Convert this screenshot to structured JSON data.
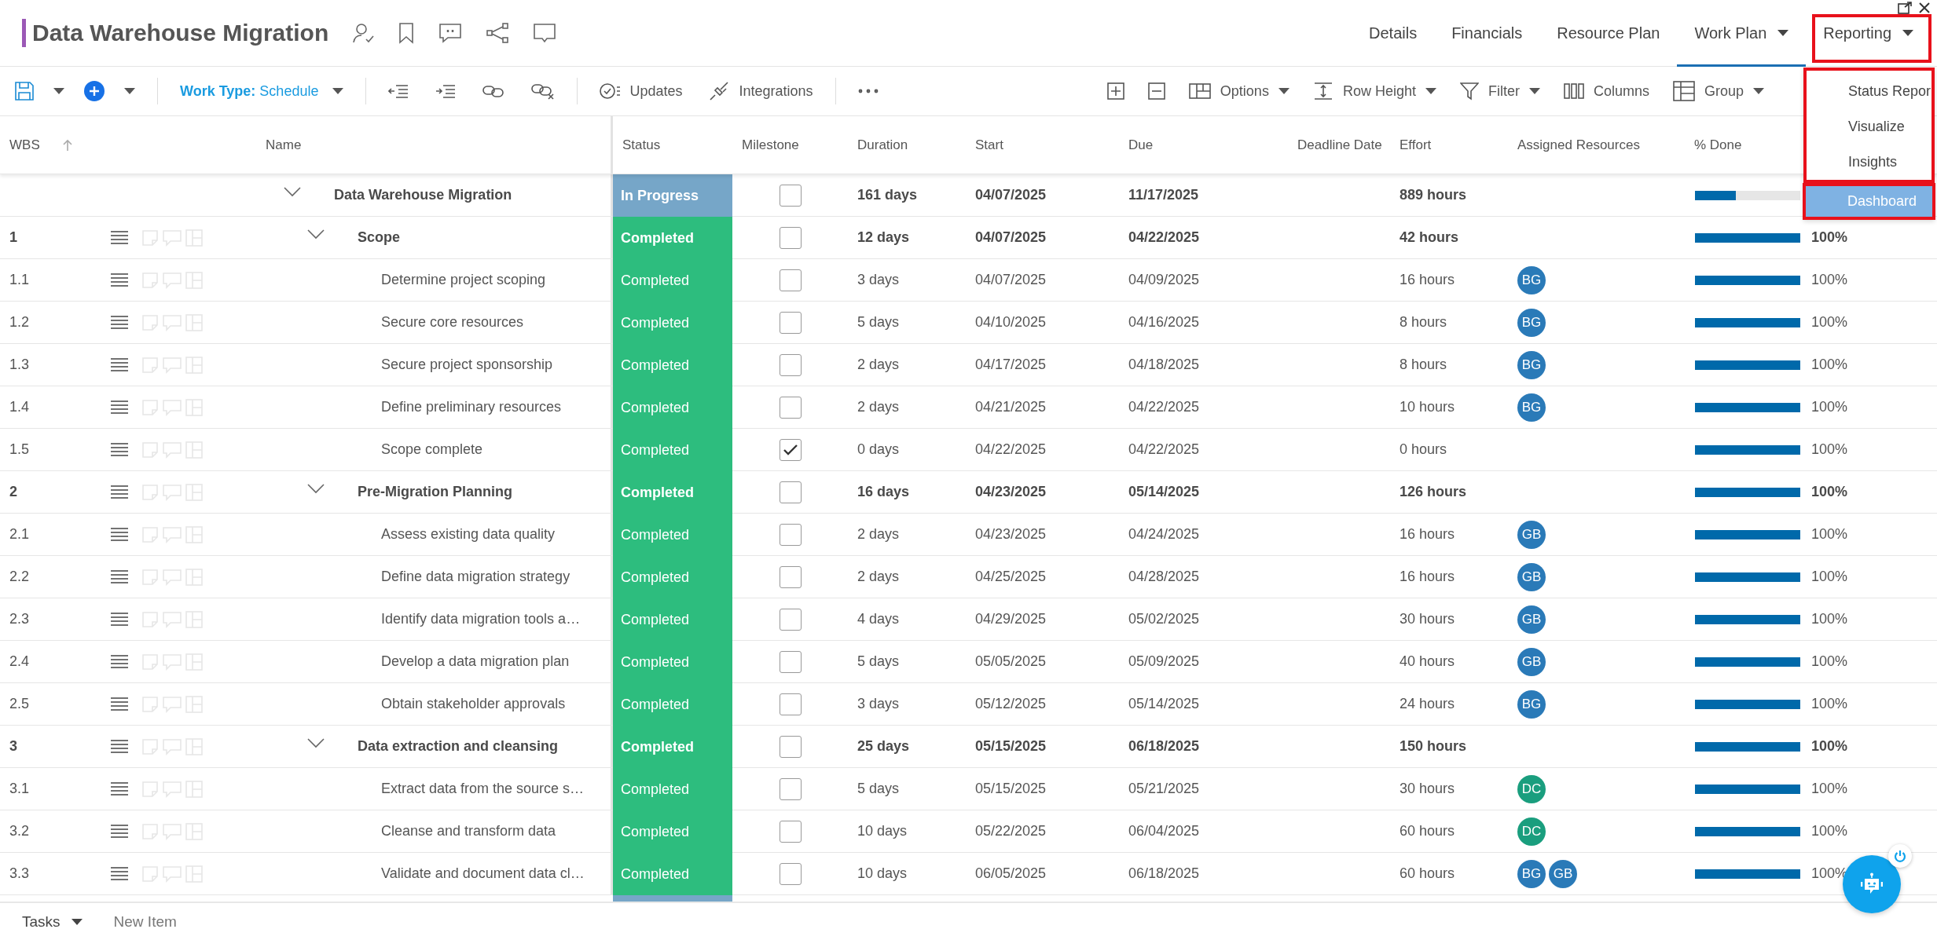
{
  "header": {
    "title": "Data Warehouse Migration",
    "tabs": [
      {
        "label": "Details",
        "selected": false,
        "dropdown": false
      },
      {
        "label": "Financials",
        "selected": false,
        "dropdown": false
      },
      {
        "label": "Resource Plan",
        "selected": false,
        "dropdown": false
      },
      {
        "label": "Work Plan",
        "selected": true,
        "dropdown": true
      },
      {
        "label": "Reporting",
        "selected": false,
        "dropdown": true
      }
    ]
  },
  "toolbar": {
    "work_type": "**Work Type:** Schedule",
    "left_buttons": [
      "Updates",
      "Integrations"
    ],
    "right_buttons": [
      {
        "label": "Options",
        "dropdown": true
      },
      {
        "label": "Row Height",
        "dropdown": true
      },
      {
        "label": "Filter",
        "dropdown": true
      },
      {
        "label": "Columns",
        "dropdown": false
      },
      {
        "label": "Group",
        "dropdown": true
      }
    ]
  },
  "table": {
    "columns": [
      {
        "label": "WBS",
        "sorted": true
      },
      {
        "label": "Name"
      },
      {
        "label": "Status"
      },
      {
        "label": "Milestone"
      },
      {
        "label": "Duration"
      },
      {
        "label": "Start"
      },
      {
        "label": "Due"
      },
      {
        "label": "Deadline Date"
      },
      {
        "label": "Effort"
      },
      {
        "label": "Assigned Resources"
      },
      {
        "label": "% Done"
      }
    ],
    "rows": [
      {
        "name": "Data Warehouse Migration",
        "expanded": true,
        "status": {
          "text": "In Progress",
          "color": "#76a6c8"
        },
        "milestone": false,
        "duration": "161 days",
        "start": "04/07/2025",
        "due": "11/17/2025",
        "effort": "889 hours",
        "level": 0.39,
        "children": [
          {
            "wbs": "1",
            "name": "Scope",
            "expanded": true,
            "status": {
              "text": "Completed",
              "color": "#2dbd7e"
            },
            "milestone": false,
            "duration": "12 days",
            "start": "04/07/2025",
            "due": "04/22/2025",
            "effort": "42 hours",
            "level": 1,
            "percent": "100%",
            "children": [
              {
                "wbs": "1.1",
                "name": "Determine project scoping",
                "status": {
                  "text": "Completed",
                  "color": "#2dbd7e"
                },
                "milestone": false,
                "duration": "3 days",
                "start": "04/07/2025",
                "due": "04/09/2025",
                "effort": "16 hours",
                "resources": [
                  {
                    "initials": "BG",
                    "color": "#2a7ab8"
                  }
                ],
                "level": 1,
                "percent": "100%"
              },
              {
                "wbs": "1.2",
                "name": "Secure core resources",
                "status": {
                  "text": "Completed",
                  "color": "#2dbd7e"
                },
                "milestone": false,
                "duration": "5 days",
                "start": "04/10/2025",
                "due": "04/16/2025",
                "effort": "8 hours",
                "resources": [
                  {
                    "initials": "BG",
                    "color": "#2a7ab8"
                  }
                ],
                "level": 1,
                "percent": "100%"
              },
              {
                "wbs": "1.3",
                "name": "Secure project sponsorship",
                "status": {
                  "text": "Completed",
                  "color": "#2dbd7e"
                },
                "milestone": false,
                "duration": "2 days",
                "start": "04/17/2025",
                "due": "04/18/2025",
                "effort": "8 hours",
                "resources": [
                  {
                    "initials": "BG",
                    "color": "#2a7ab8"
                  }
                ],
                "level": 1,
                "percent": "100%"
              },
              {
                "wbs": "1.4",
                "name": "Define preliminary resources",
                "status": {
                  "text": "Completed",
                  "color": "#2dbd7e"
                },
                "milestone": false,
                "duration": "2 days",
                "start": "04/21/2025",
                "due": "04/22/2025",
                "effort": "10 hours",
                "resources": [
                  {
                    "initials": "BG",
                    "color": "#2a7ab8"
                  }
                ],
                "level": 1,
                "percent": "100%"
              },
              {
                "wbs": "1.5",
                "name": "Scope complete",
                "status": {
                  "text": "Completed",
                  "color": "#2dbd7e"
                },
                "milestone": true,
                "duration": "0 days",
                "start": "04/22/2025",
                "due": "04/22/2025",
                "effort": "0 hours",
                "level": 1,
                "percent": "100%"
              }
            ]
          },
          {
            "wbs": "2",
            "name": "Pre-Migration Planning",
            "expanded": true,
            "status": {
              "text": "Completed",
              "color": "#2dbd7e"
            },
            "milestone": false,
            "duration": "16 days",
            "start": "04/23/2025",
            "due": "05/14/2025",
            "effort": "126 hours",
            "level": 1,
            "percent": "100%",
            "children": [
              {
                "wbs": "2.1",
                "name": "Assess existing data quality",
                "status": {
                  "text": "Completed",
                  "color": "#2dbd7e"
                },
                "milestone": false,
                "duration": "2 days",
                "start": "04/23/2025",
                "due": "04/24/2025",
                "effort": "16 hours",
                "resources": [
                  {
                    "initials": "GB",
                    "color": "#2a7ab8"
                  }
                ],
                "level": 1,
                "percent": "100%"
              },
              {
                "wbs": "2.2",
                "name": "Define data migration strategy",
                "status": {
                  "text": "Completed",
                  "color": "#2dbd7e"
                },
                "milestone": false,
                "duration": "2 days",
                "start": "04/25/2025",
                "due": "04/28/2025",
                "effort": "16 hours",
                "resources": [
                  {
                    "initials": "GB",
                    "color": "#2a7ab8"
                  }
                ],
                "level": 1,
                "percent": "100%"
              },
              {
                "wbs": "2.3",
                "name": "Identify data migration tools a…",
                "status": {
                  "text": "Completed",
                  "color": "#2dbd7e"
                },
                "milestone": false,
                "duration": "4 days",
                "start": "04/29/2025",
                "due": "05/02/2025",
                "effort": "30 hours",
                "resources": [
                  {
                    "initials": "GB",
                    "color": "#2a7ab8"
                  }
                ],
                "level": 1,
                "percent": "100%"
              },
              {
                "wbs": "2.4",
                "name": "Develop a data migration plan",
                "status": {
                  "text": "Completed",
                  "color": "#2dbd7e"
                },
                "milestone": false,
                "duration": "5 days",
                "start": "05/05/2025",
                "due": "05/09/2025",
                "effort": "40 hours",
                "resources": [
                  {
                    "initials": "GB",
                    "color": "#2a7ab8"
                  }
                ],
                "level": 1,
                "percent": "100%"
              },
              {
                "wbs": "2.5",
                "name": "Obtain stakeholder approvals",
                "status": {
                  "text": "Completed",
                  "color": "#2dbd7e"
                },
                "milestone": false,
                "duration": "3 days",
                "start": "05/12/2025",
                "due": "05/14/2025",
                "effort": "24 hours",
                "resources": [
                  {
                    "initials": "BG",
                    "color": "#2a7ab8"
                  }
                ],
                "level": 1,
                "percent": "100%"
              }
            ]
          },
          {
            "wbs": "3",
            "name": "Data extraction and cleansing",
            "expanded": true,
            "status": {
              "text": "Completed",
              "color": "#2dbd7e"
            },
            "milestone": false,
            "duration": "25 days",
            "start": "05/15/2025",
            "due": "06/18/2025",
            "effort": "150 hours",
            "level": 1,
            "percent": "100%",
            "children": [
              {
                "wbs": "3.1",
                "name": "Extract data from the source s…",
                "status": {
                  "text": "Completed",
                  "color": "#2dbd7e"
                },
                "milestone": false,
                "duration": "5 days",
                "start": "05/15/2025",
                "due": "05/21/2025",
                "effort": "30 hours",
                "resources": [
                  {
                    "initials": "DC",
                    "color": "#1a9e7e"
                  }
                ],
                "level": 1,
                "percent": "100%"
              },
              {
                "wbs": "3.2",
                "name": "Cleanse and transform data",
                "status": {
                  "text": "Completed",
                  "color": "#2dbd7e"
                },
                "milestone": false,
                "duration": "10 days",
                "start": "05/22/2025",
                "due": "06/04/2025",
                "effort": "60 hours",
                "resources": [
                  {
                    "initials": "DC",
                    "color": "#1a9e7e"
                  }
                ],
                "level": 1,
                "percent": "100%"
              },
              {
                "wbs": "3.3",
                "name": "Validate and document data cl…",
                "status": {
                  "text": "Completed",
                  "color": "#2dbd7e"
                },
                "milestone": false,
                "duration": "10 days",
                "start": "06/05/2025",
                "due": "06/18/2025",
                "effort": "60 hours",
                "resources": [
                  {
                    "initials": "BG",
                    "color": "#2a7ab8"
                  },
                  {
                    "initials": "GB",
                    "color": "#2a7ab8"
                  }
                ],
                "level": 1,
                "percent": "100%"
              }
            ]
          }
        ]
      }
    ]
  },
  "reporting_menu": {
    "items": [
      {
        "label": "Status Repor",
        "selected": false
      },
      {
        "label": "Visualize",
        "selected": false
      },
      {
        "label": "Insights",
        "selected": false
      },
      {
        "label": "Dashboard",
        "selected": true
      }
    ]
  },
  "footer": {
    "view": "Tasks",
    "new_item": "New Item"
  }
}
